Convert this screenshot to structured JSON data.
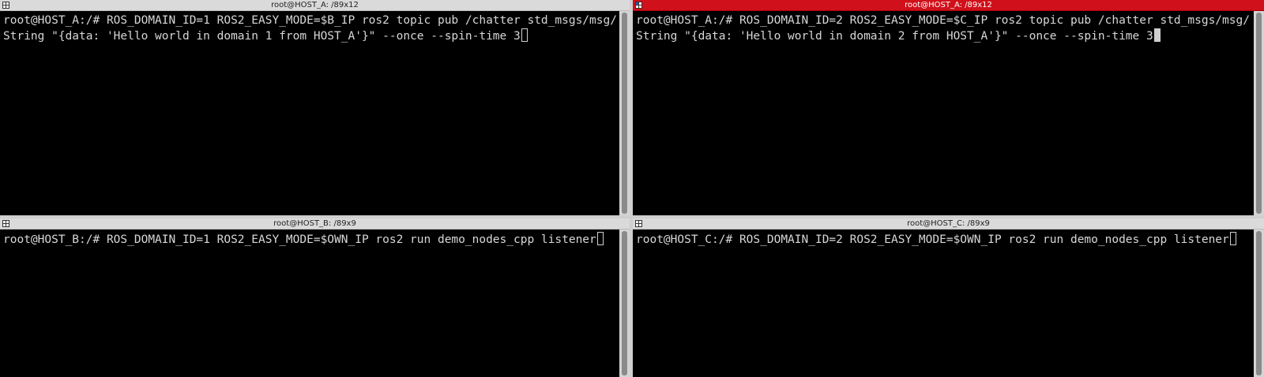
{
  "panes": {
    "top_left": {
      "title": "root@HOST_A: /89x12",
      "active": false,
      "line1": "root@HOST_A:/# ROS_DOMAIN_ID=1 ROS2_EASY_MODE=$B_IP ros2 topic pub /chatter std_msgs/msg/",
      "line2": "String \"{data: 'Hello world in domain 1 from HOST_A'}\" --once --spin-time 3"
    },
    "top_right": {
      "title": "root@HOST_A: /89x12",
      "active": true,
      "line1": "root@HOST_A:/# ROS_DOMAIN_ID=2 ROS2_EASY_MODE=$C_IP ros2 topic pub /chatter std_msgs/msg/",
      "line2": "String \"{data: 'Hello world in domain 2 from HOST_A'}\" --once --spin-time 3"
    },
    "bottom_left": {
      "title": "root@HOST_B: /89x9",
      "active": false,
      "line1": "root@HOST_B:/# ROS_DOMAIN_ID=1 ROS2_EASY_MODE=$OWN_IP ros2 run demo_nodes_cpp listener"
    },
    "bottom_right": {
      "title": "root@HOST_C: /89x9",
      "active": false,
      "line1": "root@HOST_C:/# ROS_DOMAIN_ID=2 ROS2_EASY_MODE=$OWN_IP ros2 run demo_nodes_cpp listener"
    }
  },
  "icons": {
    "pane_menu": "pane-menu-icon"
  },
  "colors": {
    "active_title": "#d0101a",
    "inactive_title": "#dadada",
    "terminal_bg": "#000000",
    "terminal_fg": "#d7d7d7"
  }
}
